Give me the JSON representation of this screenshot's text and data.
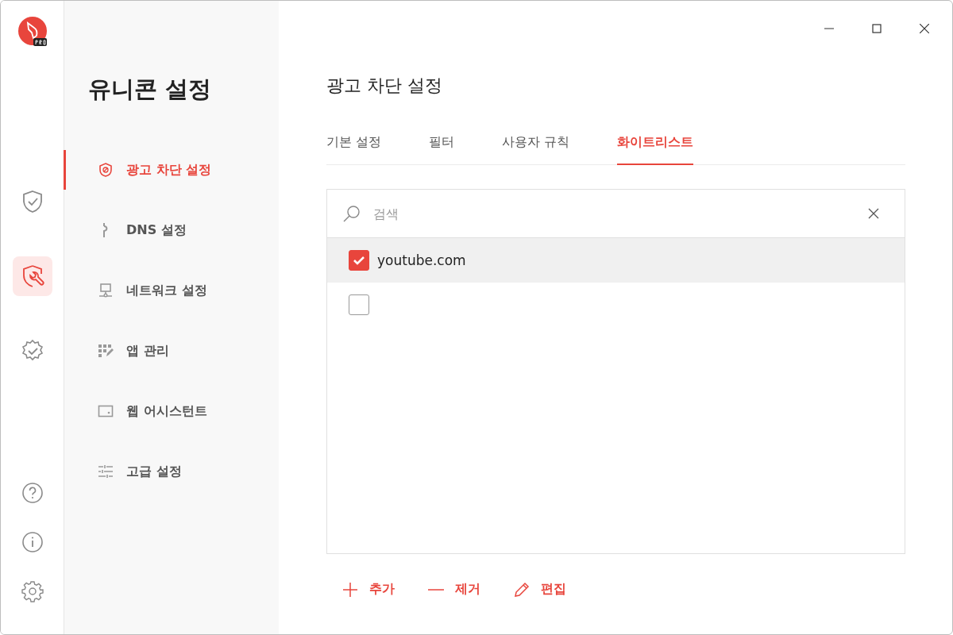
{
  "rail": {
    "items": [
      {
        "kind": "shield-check",
        "selected": false
      },
      {
        "kind": "shield-wrench",
        "selected": true
      },
      {
        "kind": "badge-check",
        "selected": false
      }
    ],
    "bottom": [
      {
        "kind": "help"
      },
      {
        "kind": "info"
      },
      {
        "kind": "settings"
      }
    ]
  },
  "sidebar": {
    "title": "유니콘 설정",
    "items": [
      {
        "label": "광고 차단 설정",
        "kind": "shield",
        "selected": true
      },
      {
        "label": "DNS 설정",
        "kind": "dns",
        "selected": false
      },
      {
        "label": "네트워크 설정",
        "kind": "network",
        "selected": false
      },
      {
        "label": "앱 관리",
        "kind": "apps",
        "selected": false
      },
      {
        "label": "웹 어시스턴트",
        "kind": "web",
        "selected": false
      },
      {
        "label": "고급 설정",
        "kind": "advanced",
        "selected": false
      }
    ]
  },
  "main": {
    "title": "광고 차단 설정",
    "tabs": [
      {
        "label": "기본 설정",
        "selected": false
      },
      {
        "label": "필터",
        "selected": false
      },
      {
        "label": "사용자 규칙",
        "selected": false
      },
      {
        "label": "화이트리스트",
        "selected": true
      }
    ],
    "search": {
      "placeholder": "검색"
    },
    "list": [
      {
        "text": "youtube.com",
        "checked": true,
        "selected": true
      },
      {
        "checked": false,
        "selected": false
      }
    ],
    "actions": [
      {
        "label": "추가",
        "kind": "add"
      },
      {
        "label": "제거",
        "kind": "remove"
      },
      {
        "label": "편집",
        "kind": "edit"
      }
    ]
  }
}
